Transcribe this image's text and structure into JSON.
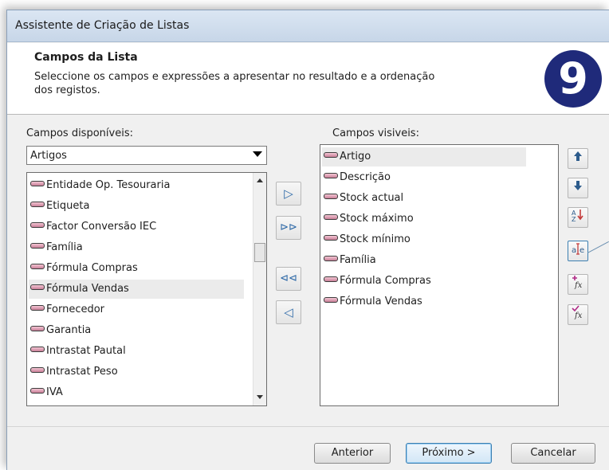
{
  "window": {
    "title": "Assistente de Criação de Listas"
  },
  "header": {
    "title": "Campos da Lista",
    "description": "Seleccione os campos e expressões a apresentar no resultado e a ordenação dos registos.",
    "logo_text": "9"
  },
  "available": {
    "label": "Campos disponíveis:",
    "category": "Artigos",
    "items": [
      "Entidade Op. Tesouraria",
      "Etiqueta",
      "Factor Conversão IEC",
      "Família",
      "Fórmula Compras",
      "Fórmula Vendas",
      "Fornecedor",
      "Garantia",
      "Intrastat Pautal",
      "Intrastat Peso",
      "IVA"
    ],
    "selected": "Fórmula Vendas"
  },
  "visible": {
    "label": "Campos visiveis:",
    "items": [
      "Artigo",
      "Descrição",
      "Stock actual",
      "Stock máximo",
      "Stock mínimo",
      "Família",
      "Fórmula Compras",
      "Fórmula Vendas"
    ],
    "selected": "Artigo"
  },
  "move_buttons": {
    "add": "▷",
    "add_all": "⊳⊳",
    "remove_all": "⊲⊲",
    "remove": "◁"
  },
  "side_buttons": {
    "up": "🡅",
    "down": "🡇",
    "sort": "A↓",
    "rename": "a|e",
    "add_expression": "fx",
    "edit_expression": "fx"
  },
  "footer": {
    "back": "Anterior",
    "next": "Próximo >",
    "cancel": "Cancelar"
  }
}
